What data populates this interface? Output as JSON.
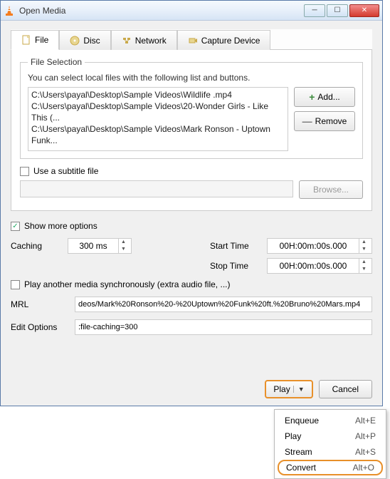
{
  "window": {
    "title": "Open Media"
  },
  "tabs": {
    "file": "File",
    "disc": "Disc",
    "network": "Network",
    "capture": "Capture Device"
  },
  "fileSelection": {
    "legend": "File Selection",
    "hint": "You can select local files with the following list and buttons.",
    "files": [
      "C:\\Users\\payal\\Desktop\\Sample Videos\\Wildlife .mp4",
      "C:\\Users\\payal\\Desktop\\Sample Videos\\20-Wonder Girls - Like This (...",
      "C:\\Users\\payal\\Desktop\\Sample Videos\\Mark Ronson - Uptown Funk..."
    ],
    "add": "Add...",
    "remove": "Remove"
  },
  "subtitle": {
    "label": "Use a subtitle file",
    "browse": "Browse..."
  },
  "options": {
    "showMore": "Show more options",
    "cachingLabel": "Caching",
    "cachingValue": "300 ms",
    "startLabel": "Start Time",
    "startValue": "00H:00m:00s.000",
    "stopLabel": "Stop Time",
    "stopValue": "00H:00m:00s.000",
    "syncLabel": "Play another media synchronously (extra audio file, ...)",
    "mrlLabel": "MRL",
    "mrlValue": "deos/Mark%20Ronson%20-%20Uptown%20Funk%20ft.%20Bruno%20Mars.mp4",
    "editLabel": "Edit Options",
    "editValue": ":file-caching=300"
  },
  "footer": {
    "play": "Play",
    "cancel": "Cancel"
  },
  "dropdown": [
    {
      "label": "Enqueue",
      "shortcut": "Alt+E"
    },
    {
      "label": "Play",
      "shortcut": "Alt+P"
    },
    {
      "label": "Stream",
      "shortcut": "Alt+S"
    },
    {
      "label": "Convert",
      "shortcut": "Alt+O"
    }
  ]
}
